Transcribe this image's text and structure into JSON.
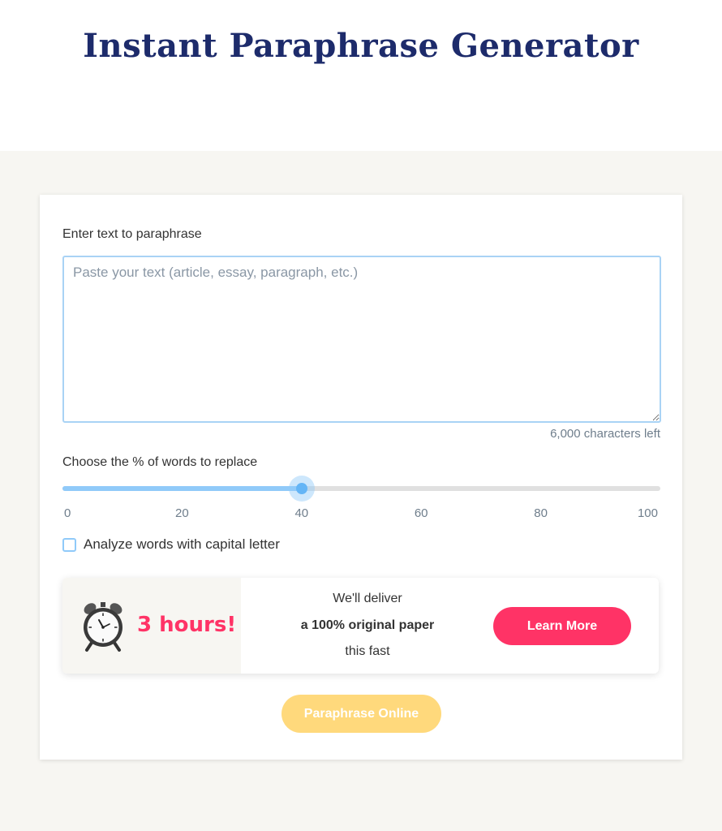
{
  "page": {
    "title": "Instant Paraphrase Generator"
  },
  "form": {
    "text_label": "Enter text to paraphrase",
    "text_placeholder": "Paste your text (article, essay, paragraph, etc.)",
    "text_value": "",
    "chars_left": "6,000 characters left",
    "slider_label": "Choose the % of words to replace",
    "slider_value": 40,
    "slider_min": 0,
    "slider_max": 100,
    "slider_ticks": [
      "0",
      "20",
      "40",
      "60",
      "80",
      "100"
    ],
    "checkbox_label": "Analyze words with capital letter",
    "checkbox_checked": false
  },
  "promo": {
    "icon": "alarm-clock-icon",
    "time": "3 hours!",
    "line1": "We'll deliver",
    "line2": "a 100% original paper",
    "line3": "this fast",
    "button_label": "Learn More"
  },
  "action": {
    "button_label": "Paraphrase Online"
  },
  "colors": {
    "title": "#1d2b6b",
    "accent_pink": "#ff3366",
    "accent_yellow": "#ffd97c",
    "slider_blue": "#64b5f6",
    "background": "#f7f6f2"
  }
}
